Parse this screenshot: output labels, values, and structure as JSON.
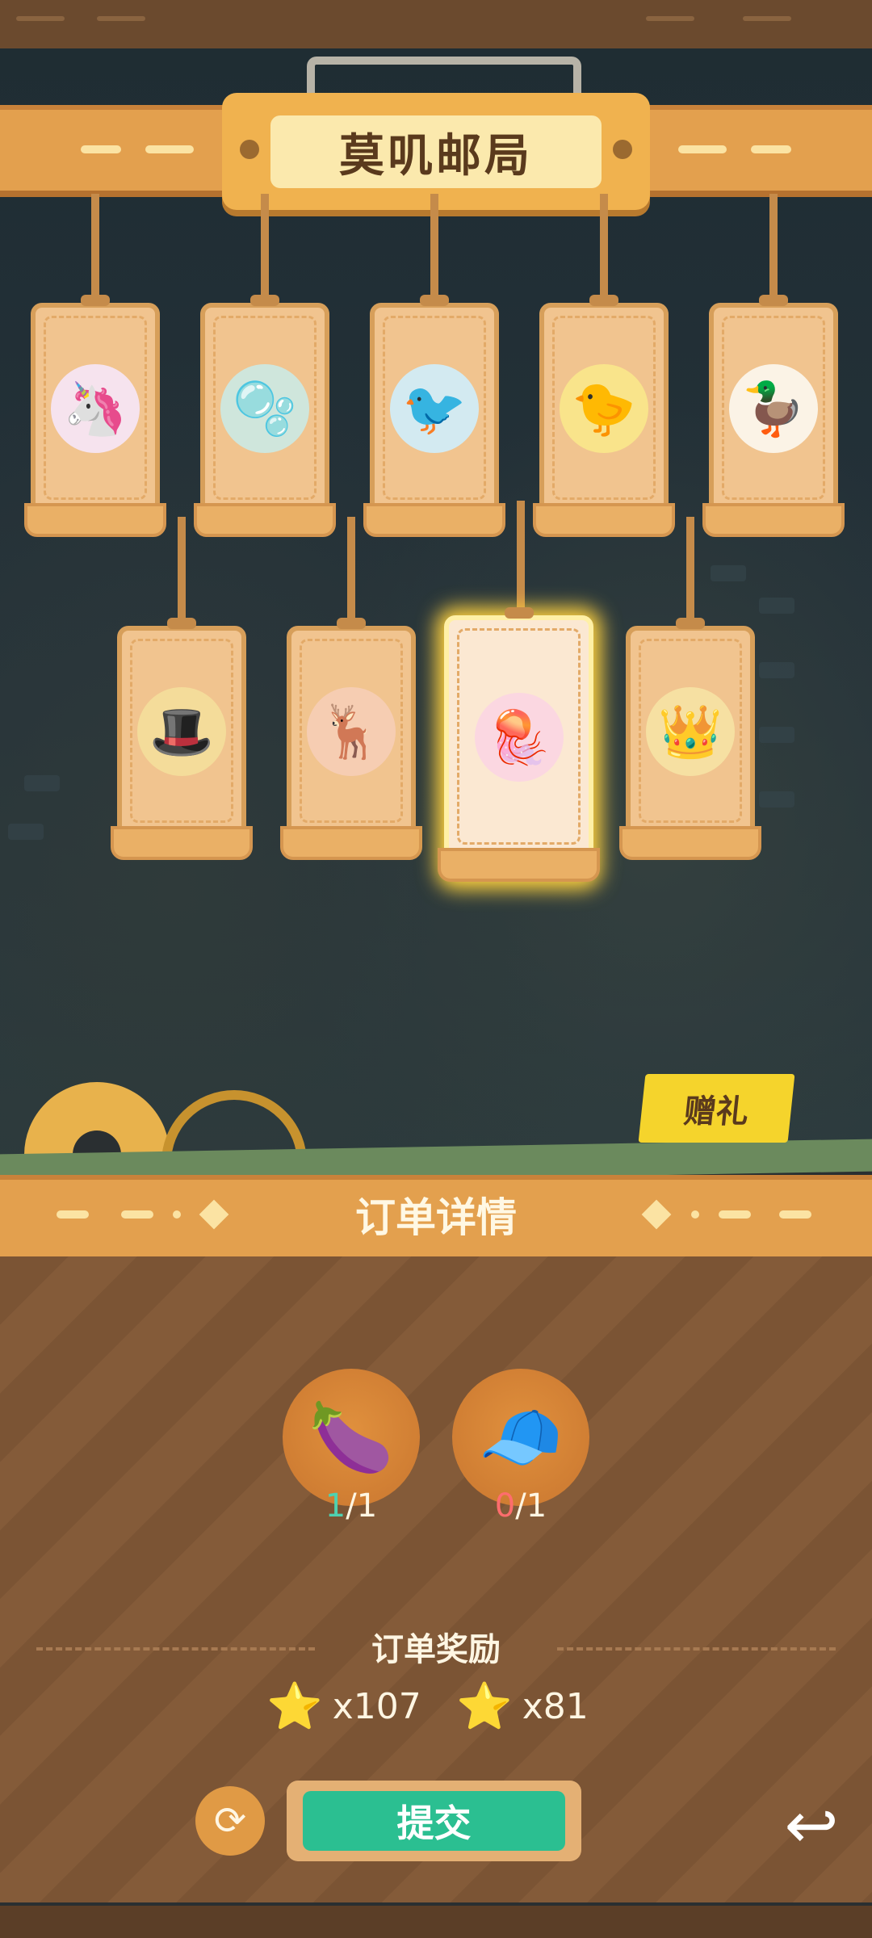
{
  "header": {
    "title": "莫叽邮局"
  },
  "characters": [
    {
      "name": "unicorn",
      "icon": "🦄",
      "selected": false
    },
    {
      "name": "bubble-fish",
      "icon": "🫧",
      "selected": false
    },
    {
      "name": "blue-bird",
      "icon": "🐦",
      "selected": false
    },
    {
      "name": "pink-chick",
      "icon": "🐤",
      "selected": false
    },
    {
      "name": "duck",
      "icon": "🦆",
      "selected": false
    },
    {
      "name": "hat-creature",
      "icon": "🎩",
      "selected": false
    },
    {
      "name": "deer",
      "icon": "🦌",
      "selected": false
    },
    {
      "name": "jellyfish",
      "icon": "🪼",
      "selected": true
    },
    {
      "name": "prince",
      "icon": "👑",
      "selected": false
    }
  ],
  "gift": {
    "label": "赠礼"
  },
  "order": {
    "title": "订单详情",
    "items": [
      {
        "name": "lavender-pouch",
        "icon": "🍆",
        "have": "1",
        "need": "/1"
      },
      {
        "name": "night-cap",
        "icon": "🧢",
        "have": "0",
        "need": "/1"
      }
    ],
    "reward_label": "订单奖励",
    "rewards": [
      {
        "name": "green-star",
        "icon": "⭐",
        "amount": "x107"
      },
      {
        "name": "blue-star",
        "icon": "⭐",
        "amount": "x81"
      }
    ]
  },
  "actions": {
    "submit_label": "提交",
    "refresh_icon": "⟳",
    "back_icon": "↩"
  },
  "colors": {
    "plank": "#e3a04e",
    "submit": "#2bbf91",
    "highlight": "#ffd23f"
  }
}
